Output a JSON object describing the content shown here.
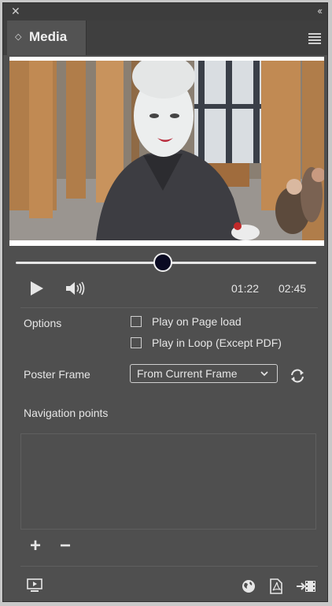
{
  "window": {
    "close_icon": "close-icon",
    "collapse_icon": "double-chevron-icon"
  },
  "tab": {
    "title": "Media"
  },
  "player": {
    "progress": 0.49,
    "current_time": "01:22",
    "total_time": "02:45"
  },
  "options": {
    "label": "Options",
    "play_on_page_load": {
      "label": "Play on Page load",
      "checked": false
    },
    "play_in_loop": {
      "label": "Play in Loop (Except PDF)",
      "checked": false
    }
  },
  "poster": {
    "label": "Poster Frame",
    "selected": "From Current Frame"
  },
  "navigation": {
    "label": "Navigation points",
    "items": []
  },
  "colors": {
    "panel": "#4f4f4f",
    "titlebar": "#3d3d3d",
    "text": "#e6e6e6",
    "knob": "#0a0a22"
  }
}
